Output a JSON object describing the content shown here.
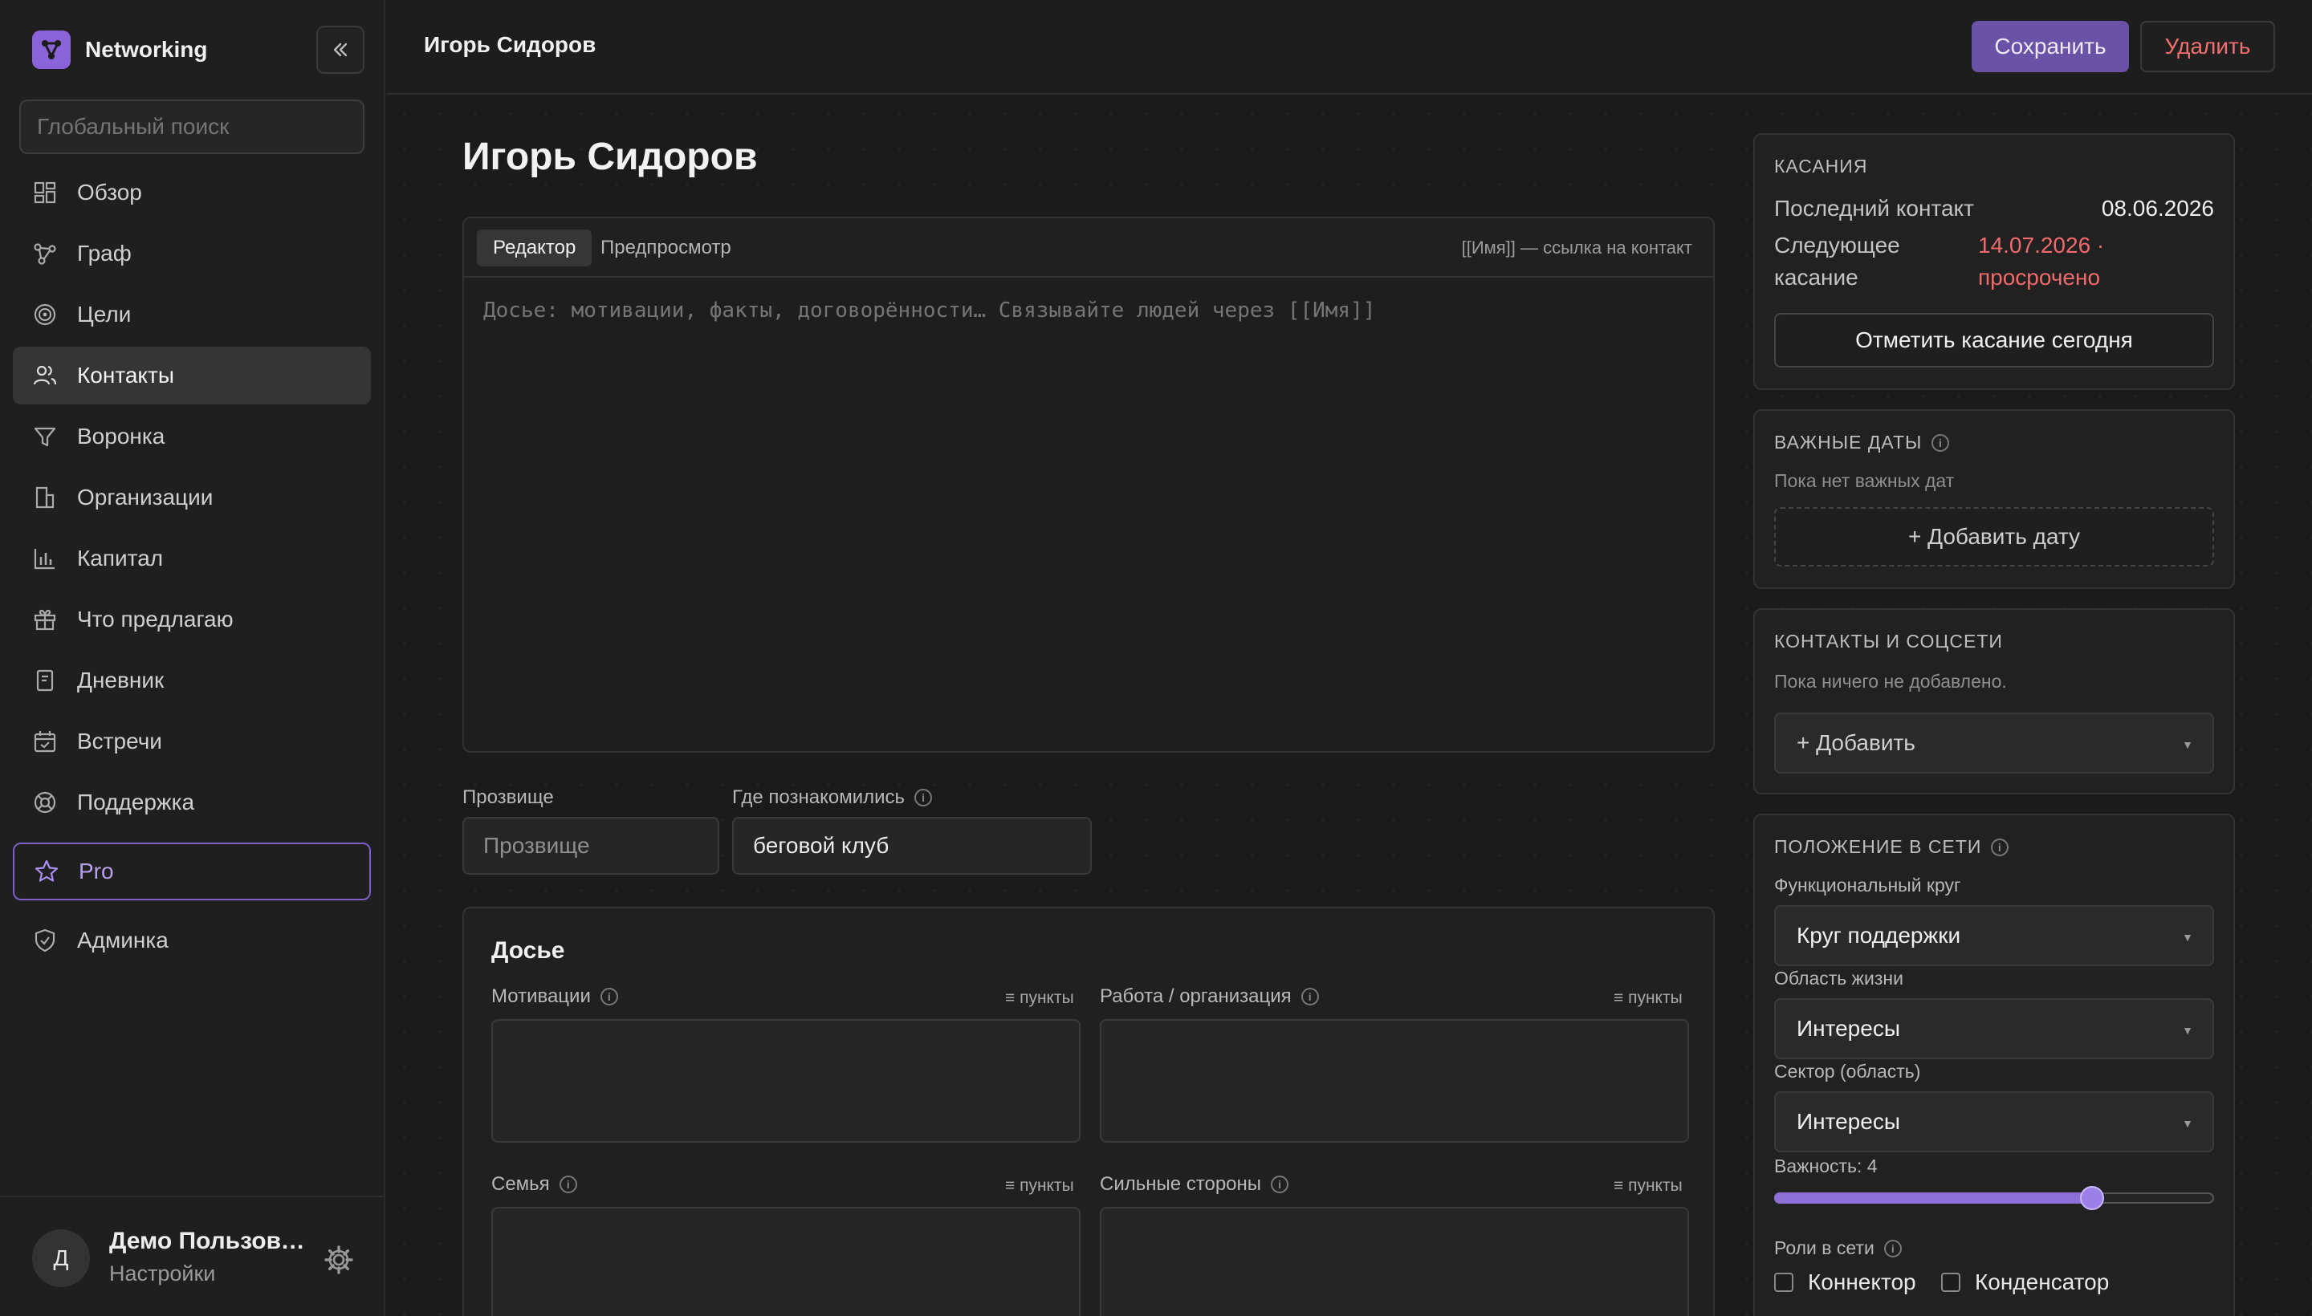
{
  "app": {
    "name": "Networking"
  },
  "sidebar": {
    "search_placeholder": "Глобальный поиск",
    "items": [
      {
        "label": "Обзор",
        "icon": "dashboard-icon"
      },
      {
        "label": "Граф",
        "icon": "graph-icon"
      },
      {
        "label": "Цели",
        "icon": "target-icon"
      },
      {
        "label": "Контакты",
        "icon": "users-icon",
        "active": true
      },
      {
        "label": "Воронка",
        "icon": "funnel-icon"
      },
      {
        "label": "Организации",
        "icon": "building-icon"
      },
      {
        "label": "Капитал",
        "icon": "bar-chart-icon"
      },
      {
        "label": "Что предлагаю",
        "icon": "gift-icon"
      },
      {
        "label": "Дневник",
        "icon": "notebook-icon"
      },
      {
        "label": "Встречи",
        "icon": "calendar-icon"
      },
      {
        "label": "Поддержка",
        "icon": "lifebuoy-icon"
      }
    ],
    "pro_label": "Pro",
    "admin_label": "Админка",
    "user": {
      "initial": "Д",
      "name": "Демо Пользователь",
      "settings": "Настройки"
    }
  },
  "topbar": {
    "title": "Игорь Сидоров",
    "save_label": "Сохранить",
    "delete_label": "Удалить"
  },
  "main": {
    "heading": "Игорь Сидоров",
    "editor": {
      "tab_editor": "Редактор",
      "tab_preview": "Предпросмотр",
      "hint": "[[Имя]] — ссылка на контакт",
      "placeholder": "Досье: мотивации, факты, договорённости… Связывайте людей через [[Имя]]"
    },
    "nickname": {
      "label": "Прозвище",
      "placeholder": "Прозвище"
    },
    "met_where": {
      "label": "Где познакомились",
      "value": "беговой клуб"
    },
    "dossier": {
      "title": "Досье",
      "points_label": "≡ пункты",
      "fields": [
        "Мотивации",
        "Работа / организация",
        "Семья",
        "Сильные стороны"
      ]
    }
  },
  "touches": {
    "title": "КАСАНИЯ",
    "last_label": "Последний контакт",
    "last_value": "08.06.2026",
    "next_label_1": "Следующее",
    "next_label_2": "касание",
    "next_value_1": "14.07.2026 ·",
    "next_value_2": "просрочено",
    "mark_button": "Отметить касание сегодня",
    "overdue_color": "#ef6a6a"
  },
  "dates": {
    "title": "ВАЖНЫЕ ДАТЫ",
    "empty": "Пока нет важных дат",
    "add_button": "+ Добавить дату"
  },
  "socials": {
    "title": "КОНТАКТЫ И СОЦСЕТИ",
    "empty": "Пока ничего не добавлено.",
    "add_button": "+ Добавить"
  },
  "network": {
    "title": "ПОЛОЖЕНИЕ В СЕТИ",
    "circle_label": "Функциональный круг",
    "circle_value": "Круг поддержки",
    "life_label": "Область жизни",
    "life_value": "Интересы",
    "sector_label": "Сектор (область)",
    "sector_value": "Интересы",
    "importance_label": "Важность: 4",
    "importance_value": 4,
    "importance_max": 5,
    "roles_label": "Роли в сети",
    "roles": [
      "Коннектор",
      "Конденсатор"
    ]
  },
  "colors": {
    "accent": "#8b63d8",
    "danger": "#f07070"
  }
}
